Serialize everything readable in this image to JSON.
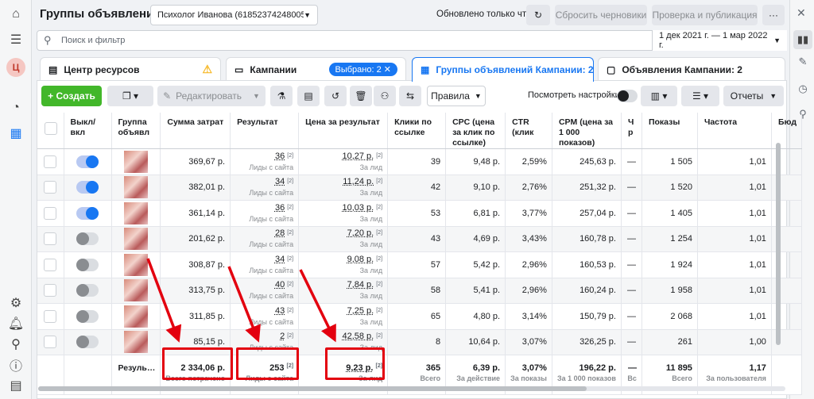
{
  "header": {
    "title": "Группы объявлений",
    "account": "Психолог Иванова (61852374248005…",
    "status": "Обновлено только что",
    "discard_label": "Сбросить черновики",
    "review_label": "Проверка и публикация",
    "more_label": "···"
  },
  "search": {
    "placeholder": "Поиск и фильтр",
    "date_range": "1 дек 2021 г. — 1 мар 2022 г."
  },
  "tabs": {
    "resources": "Центр ресурсов",
    "campaigns": "Кампании",
    "selected": "Выбрано: 2",
    "adsets": "Группы объявлений Кампании: 2",
    "ads": "Объявления Кампании: 2"
  },
  "toolbar": {
    "create": "+ Создать",
    "edit": "Редактировать",
    "rules": "Правила",
    "view_settings": "Посмотреть настройки",
    "reports": "Отчеты"
  },
  "columns": {
    "onoff": "Выкл/ вкл",
    "adset": "Группа объявл",
    "spend": "Сумма затрат",
    "results": "Результат",
    "cpr": "Цена за результат",
    "clicks": "Клики по ссылке",
    "cpc": "CPC (цена за клик по ссылке)",
    "ctr": "CTR (клик",
    "cpm": "CPM (цена за 1 000 показов)",
    "narrow": "Ч р",
    "impressions": "Показы",
    "frequency": "Частота",
    "budget": "Бюд"
  },
  "rows": [
    {
      "on": true,
      "spend": "369,67 р.",
      "results": "36",
      "res_sub": "Лиды с сайта",
      "cpr": "10,27 р.",
      "cpr_sub": "За лид",
      "clicks": "39",
      "cpc": "9,48 р.",
      "ctr": "2,59%",
      "cpm": "245,63 р.",
      "narrow": "—",
      "impr": "1 505",
      "freq": "1,01"
    },
    {
      "on": true,
      "spend": "382,01 р.",
      "results": "34",
      "res_sub": "Лиды с сайта",
      "cpr": "11,24 р.",
      "cpr_sub": "За лид",
      "clicks": "42",
      "cpc": "9,10 р.",
      "ctr": "2,76%",
      "cpm": "251,32 р.",
      "narrow": "—",
      "impr": "1 520",
      "freq": "1,01"
    },
    {
      "on": true,
      "spend": "361,14 р.",
      "results": "36",
      "res_sub": "Лиды с сайта",
      "cpr": "10,03 р.",
      "cpr_sub": "За лид",
      "clicks": "53",
      "cpc": "6,81 р.",
      "ctr": "3,77%",
      "cpm": "257,04 р.",
      "narrow": "—",
      "impr": "1 405",
      "freq": "1,01"
    },
    {
      "on": false,
      "spend": "201,62 р.",
      "results": "28",
      "res_sub": "Лиды с сайта",
      "cpr": "7,20 р.",
      "cpr_sub": "За лид",
      "clicks": "43",
      "cpc": "4,69 р.",
      "ctr": "3,43%",
      "cpm": "160,78 р.",
      "narrow": "—",
      "impr": "1 254",
      "freq": "1,01"
    },
    {
      "on": false,
      "spend": "308,87 р.",
      "results": "34",
      "res_sub": "Лиды с сайта",
      "cpr": "9,08 р.",
      "cpr_sub": "За лид",
      "clicks": "57",
      "cpc": "5,42 р.",
      "ctr": "2,96%",
      "cpm": "160,53 р.",
      "narrow": "—",
      "impr": "1 924",
      "freq": "1,01"
    },
    {
      "on": false,
      "spend": "313,75 р.",
      "results": "40",
      "res_sub": "Лиды с сайта",
      "cpr": "7,84 р.",
      "cpr_sub": "За лид",
      "clicks": "58",
      "cpc": "5,41 р.",
      "ctr": "2,96%",
      "cpm": "160,24 р.",
      "narrow": "—",
      "impr": "1 958",
      "freq": "1,01"
    },
    {
      "on": false,
      "spend": "311,85 р.",
      "results": "43",
      "res_sub": "Лиды с сайта",
      "cpr": "7,25 р.",
      "cpr_sub": "За лид",
      "clicks": "65",
      "cpc": "4,80 р.",
      "ctr": "3,14%",
      "cpm": "150,79 р.",
      "narrow": "—",
      "impr": "2 068",
      "freq": "1,01"
    },
    {
      "on": false,
      "spend": "85,15 р.",
      "results": "2",
      "res_sub": "Лиды с сайта",
      "cpr": "42,58 р.",
      "cpr_sub": "За лид",
      "clicks": "8",
      "cpc": "10,64 р.",
      "ctr": "3,07%",
      "cpm": "326,25 р.",
      "narrow": "—",
      "impr": "261",
      "freq": "1,00"
    }
  ],
  "totals": {
    "label": "Резуль…",
    "spend": "2 334,06 р.",
    "spend_sub": "Всего потрачено",
    "results": "253",
    "results_sub": "Лиды с сайта",
    "cpr": "9,23 р.",
    "cpr_sub": "За лид",
    "clicks": "365",
    "clicks_sub": "Всего",
    "cpc": "6,39 р.",
    "cpc_sub": "За действие",
    "ctr": "3,07%",
    "ctr_sub": "За показы",
    "cpm": "196,22 р.",
    "cpm_sub": "За 1 000 показов",
    "narrow": "—",
    "narrow_sub": "Вс",
    "impr": "11 895",
    "impr_sub": "Всего",
    "freq": "1,17",
    "freq_sub": "За пользователя"
  },
  "sup_mark": "[2]",
  "colors": {
    "accent": "#1877f2",
    "create": "#42b72a",
    "highlight": "#e3000f"
  }
}
